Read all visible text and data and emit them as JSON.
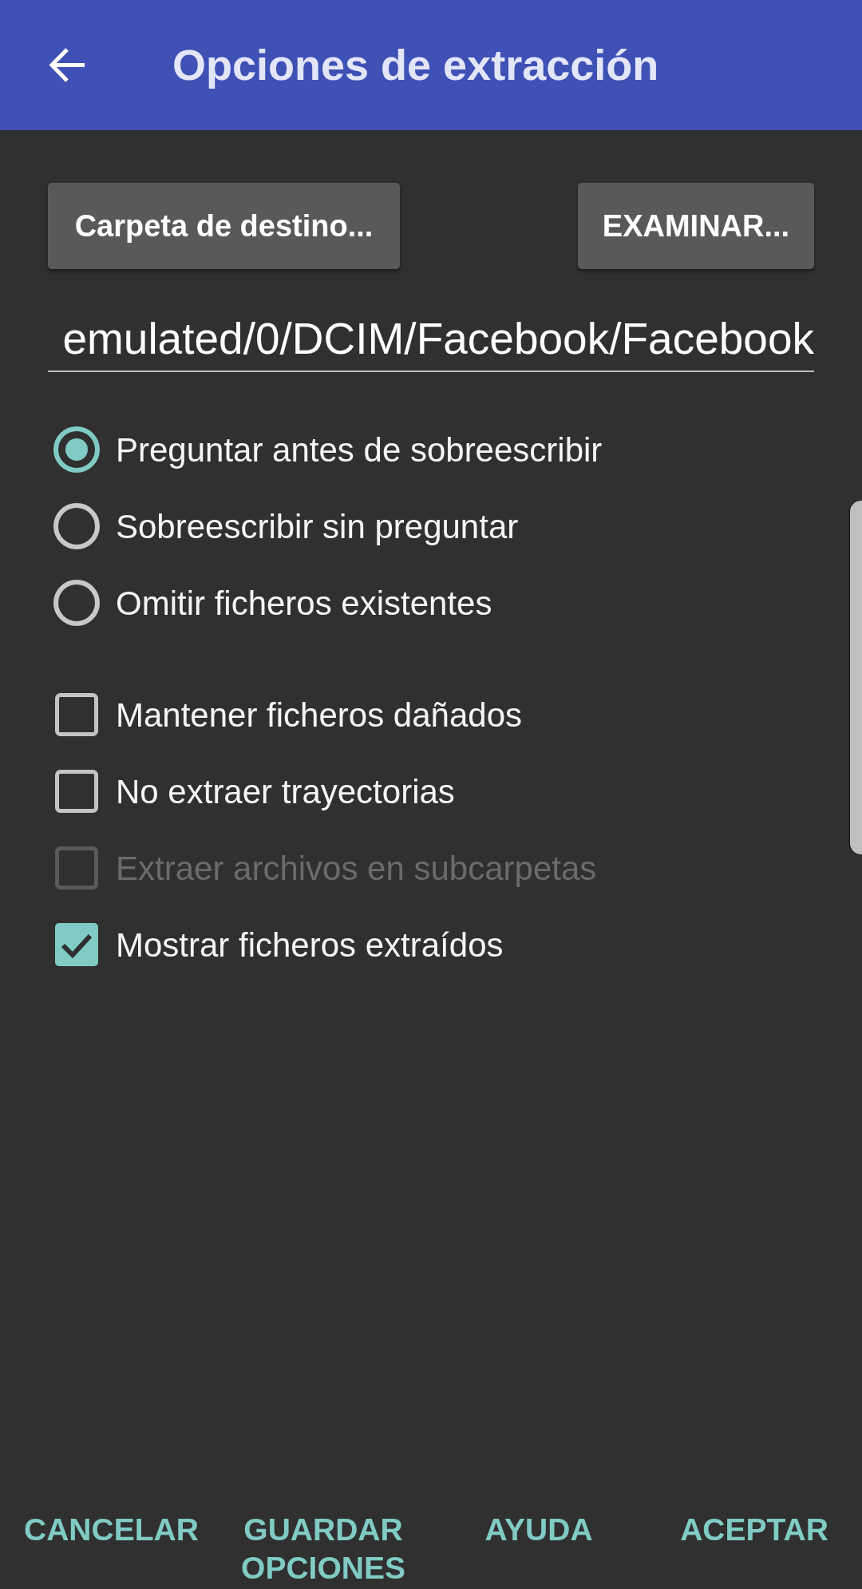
{
  "app_bar": {
    "title": "Opciones de extracción"
  },
  "destination": {
    "label_button": "Carpeta de destino...",
    "browse_button": "EXAMINAR...",
    "path": "emulated/0/DCIM/Facebook/Facebook"
  },
  "overwrite_options": [
    {
      "label": "Preguntar antes de sobreescribir",
      "selected": true
    },
    {
      "label": "Sobreescribir sin preguntar",
      "selected": false
    },
    {
      "label": "Omitir ficheros existentes",
      "selected": false
    }
  ],
  "options": [
    {
      "label": "Mantener ficheros dañados",
      "checked": false,
      "disabled": false
    },
    {
      "label": "No extraer trayectorias",
      "checked": false,
      "disabled": false
    },
    {
      "label": "Extraer archivos en subcarpetas",
      "checked": false,
      "disabled": true
    },
    {
      "label": "Mostrar ficheros extraídos",
      "checked": true,
      "disabled": false
    }
  ],
  "actions": [
    "CANCELAR",
    "GUARDAR OPCIONES",
    "AYUDA",
    "ACEPTAR"
  ]
}
